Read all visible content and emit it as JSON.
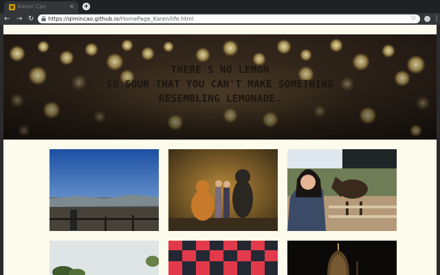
{
  "browser": {
    "tab_title": "Karen Cao",
    "close_glyph": "×",
    "new_tab_glyph": "+",
    "nav": {
      "back": "←",
      "forward": "→",
      "reload": "↻"
    },
    "url_host": "https://qimincao.github.io",
    "url_path": "/HomePage_Karen/life.html",
    "star_glyph": "☆",
    "menu_glyph": "⋮"
  },
  "hero": {
    "quote_lines": [
      "THERE'S NO LEMON",
      "SO SOUR THAT YOU CAN'T MAKE SOMETHING",
      "RESEMBLING LEMONADE."
    ]
  },
  "gallery": {
    "photos": [
      {
        "name": "photo-mountain-view",
        "subject": "city view from a mountain under blue sky"
      },
      {
        "name": "photo-mascots",
        "subject": "people posing with bear and monkey mascots"
      },
      {
        "name": "photo-horse-selfie",
        "subject": "selfie with a horse at a fence"
      },
      {
        "name": "photo-foliage",
        "subject": "leaves against a pale sky"
      },
      {
        "name": "photo-checkered",
        "subject": "red and black checkered pattern"
      },
      {
        "name": "photo-night-dome",
        "subject": "ornate dome at night"
      }
    ]
  },
  "colors": {
    "page_background": "#fdfcec",
    "browser_dark": "#202124",
    "toolbar": "#35363a"
  }
}
